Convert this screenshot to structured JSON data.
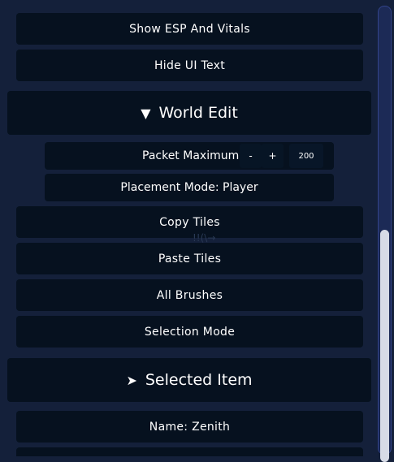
{
  "buttons": {
    "show_esp": "Show ESP And Vitals",
    "hide_ui": "Hide UI Text",
    "copy_tiles": "Copy Tiles",
    "paste_tiles": "Paste Tiles",
    "all_brushes": "All Brushes",
    "selection_mode": "Selection Mode"
  },
  "world_edit": {
    "title": "World Edit",
    "arrow": "▼",
    "packet_label": "Packet Maximum",
    "minus": "-",
    "plus": "+",
    "packet_value": "200",
    "placement": "Placement Mode: Player"
  },
  "selected_item": {
    "title": "Selected Item",
    "arrow": "➤",
    "name": "Name: Zenith"
  },
  "watermark": "!!(\\→"
}
